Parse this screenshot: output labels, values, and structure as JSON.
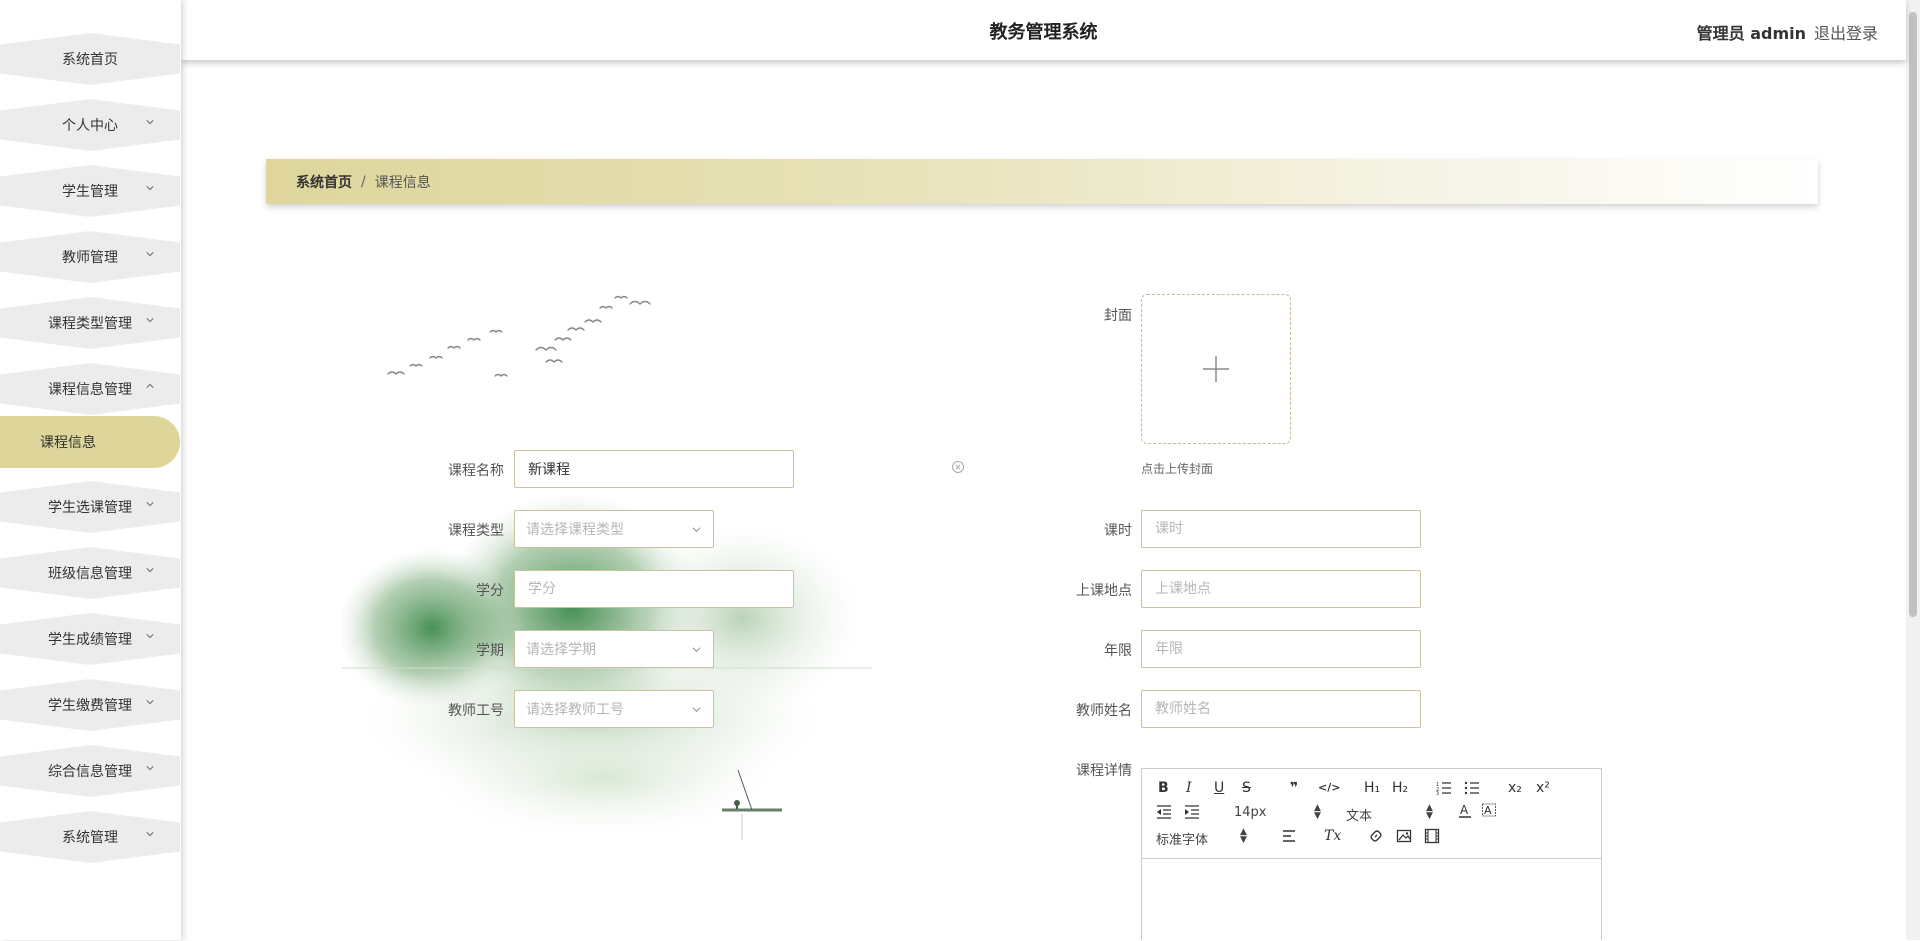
{
  "app": {
    "title": "教务管理系统",
    "user": "管理员 admin",
    "logout": "退出登录"
  },
  "sidebar": {
    "items": [
      {
        "label": "系统首页"
      },
      {
        "label": "个人中心"
      },
      {
        "label": "学生管理"
      },
      {
        "label": "教师管理"
      },
      {
        "label": "课程类型管理"
      },
      {
        "label": "课程信息管理"
      },
      {
        "label": "学生选课管理"
      },
      {
        "label": "班级信息管理"
      },
      {
        "label": "学生成绩管理"
      },
      {
        "label": "学生缴费管理"
      },
      {
        "label": "综合信息管理"
      },
      {
        "label": "系统管理"
      }
    ],
    "active_sub": "课程信息"
  },
  "breadcrumb": {
    "home": "系统首页",
    "separator": "/",
    "current": "课程信息"
  },
  "form": {
    "course_name": {
      "label": "课程名称",
      "value": "新课程"
    },
    "course_type": {
      "label": "课程类型",
      "placeholder": "请选择课程类型"
    },
    "credit": {
      "label": "学分",
      "placeholder": "学分"
    },
    "semester": {
      "label": "学期",
      "placeholder": "请选择学期"
    },
    "teacher_id": {
      "label": "教师工号",
      "placeholder": "请选择教师工号"
    },
    "cover": {
      "label": "封面",
      "hint": "点击上传封面"
    },
    "hours": {
      "label": "课时",
      "placeholder": "课时"
    },
    "location": {
      "label": "上课地点",
      "placeholder": "上课地点"
    },
    "years": {
      "label": "年限",
      "placeholder": "年限"
    },
    "teacher_name": {
      "label": "教师姓名",
      "placeholder": "教师姓名"
    },
    "details": {
      "label": "课程详情"
    }
  },
  "editor": {
    "font_size": "14px",
    "block_type": "文本",
    "font_family": "标准字体",
    "h1": "H₁",
    "h2": "H₂",
    "bold": "B",
    "italic": "I",
    "underline": "U",
    "strike": "S",
    "quote": "❞",
    "code": "</>",
    "subscript": "x₂",
    "superscript": "x²",
    "clean": "Tx"
  },
  "colors": {
    "accent": "#ddd599",
    "border": "#c9c3a0",
    "menu_bg": "#ececec"
  }
}
